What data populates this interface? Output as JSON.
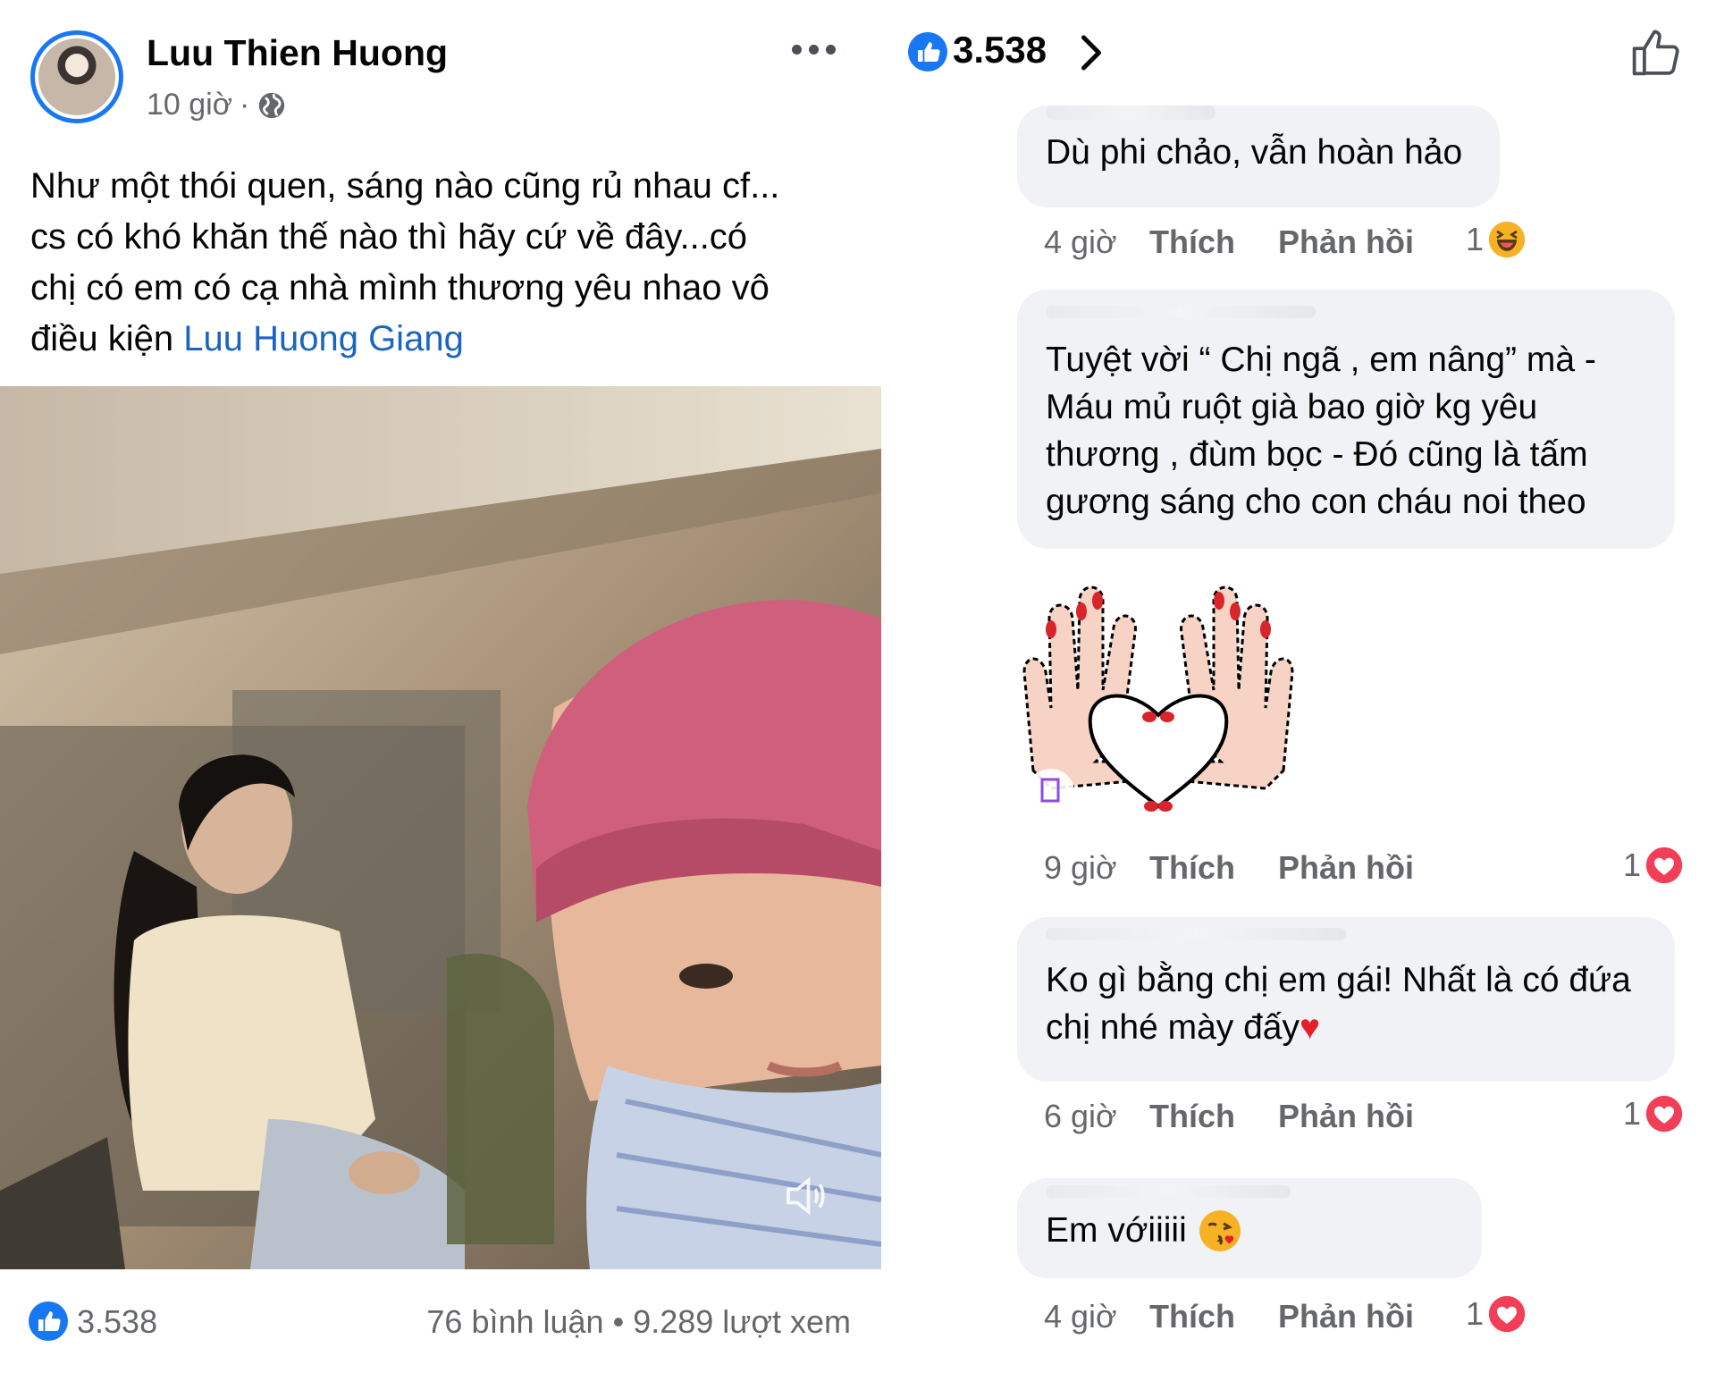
{
  "post": {
    "author": "Luu Thien Huong",
    "time": "10 giờ",
    "time_sep": "·",
    "text_lines": [
      "Như một thói quen, sáng nào cũng rủ nhau cf...",
      "cs có khó khăn thế nào thì hãy cứ về đây...có",
      "chị có em có cạ nhà mình thương yêu nhao vô",
      "điều kiện "
    ],
    "mention": "Luu Huong Giang",
    "like_count": "3.538",
    "stats": "76 bình luận • 9.289 lượt xem"
  },
  "comments_header": {
    "reaction_total": "3.538"
  },
  "comments": [
    {
      "text": "Dù phi chảo, vẫn hoàn hảo",
      "time": "4 giờ",
      "like": "Thích",
      "reply": "Phản hồi",
      "reaction_count": "1",
      "reaction": "haha-icon"
    },
    {
      "text": "Tuyệt vời “ Chị ngã , em nâng” mà - Máu mủ ruột già bao giờ kg yêu thương , đùm bọc - Đó cũng là tấm gương sáng cho con cháu noi theo",
      "time": "9 giờ",
      "like": "Thích",
      "reply": "Phản hồi",
      "reaction_count": "1",
      "reaction": "love-icon"
    },
    {
      "text": "Ko gì bằng chị em gái! Nhất là có đứa chị nhé mày đấy",
      "text_emoji": "♥",
      "time": "6 giờ",
      "like": "Thích",
      "reply": "Phản hồi",
      "reaction_count": "1",
      "reaction": "love-icon"
    },
    {
      "text": "Em vớiiiii",
      "time": "4 giờ",
      "like": "Thích",
      "reply": "Phản hồi",
      "reaction_count": "1",
      "reaction": "love-icon"
    }
  ],
  "colors": {
    "facebook_blue": "#1877f2",
    "mention_blue": "#1b65c0",
    "love_red": "#f33e58",
    "bubble_gray": "#f0f2f5"
  }
}
